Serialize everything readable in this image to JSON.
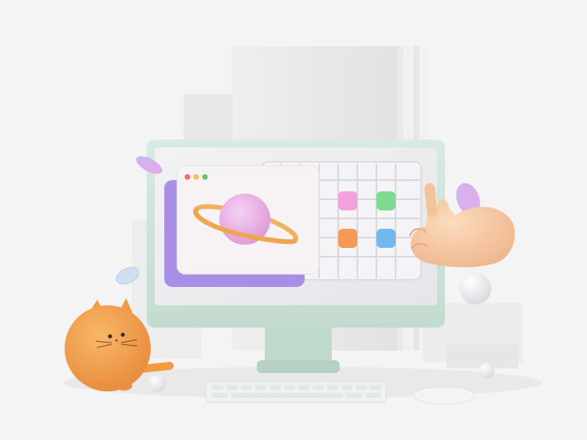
{
  "scene": {
    "subject": "3d-desktop-computer-illustration",
    "colors": {
      "background": "#f4f4f4",
      "monitor_frame": "#cfe3d9",
      "screen": "#ececf0",
      "window_card": "#f7f3f5",
      "purple_card": "#a98ee8",
      "planet": "#e9b3e6",
      "ring": "#f1b25e",
      "cat": "#f3a24a",
      "hand": "#f6c79f",
      "tile_pink": "#f3a2dd",
      "tile_green": "#7fdb8f",
      "tile_orange": "#f59a55",
      "tile_blue": "#72b8ee"
    },
    "icons": [
      "window-traffic-light-icon",
      "planet-icon",
      "cat-icon",
      "hand-icon"
    ]
  }
}
